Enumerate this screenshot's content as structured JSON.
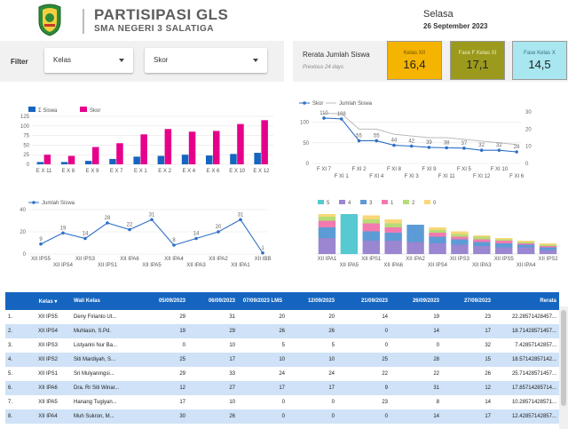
{
  "header": {
    "title": "PARTISIPASI GLS",
    "subtitle": "SMA NEGERI 3 SALATIGA",
    "day": "Selasa",
    "date": "26 September 2023",
    "logo_icon": "school-crest-icon"
  },
  "filter": {
    "label": "Filter",
    "dropdowns": [
      {
        "label": "Kelas"
      },
      {
        "label": "Skor"
      }
    ]
  },
  "kpi": {
    "title": "Rerata Jumlah Siswa",
    "subtitle": "Previous 24 days",
    "cards": [
      {
        "name": "Kelas XII",
        "value": "16,4",
        "color": "#f5b400"
      },
      {
        "name": "Fase F Kelas XI",
        "value": "17,1",
        "color": "#9c9a1c"
      },
      {
        "name": "Fase Kelas X",
        "value": "14,5",
        "color": "#a8e6f0"
      }
    ]
  },
  "chart_data": [
    {
      "type": "bar",
      "legend": [
        "Σ Siswa",
        "Skor"
      ],
      "colors": [
        "#1565c0",
        "#e6008a"
      ],
      "categories": [
        "E X 11",
        "E X 8",
        "E X 9",
        "E X 7",
        "E X 1",
        "E X 2",
        "E X 4",
        "E X 6",
        "E X 10",
        "E X 12"
      ],
      "series": [
        {
          "name": "Σ Siswa",
          "values": [
            6,
            6,
            9,
            14,
            20,
            22,
            25,
            23,
            27,
            30
          ]
        },
        {
          "name": "Skor",
          "values": [
            25,
            22,
            45,
            55,
            78,
            92,
            85,
            87,
            105,
            115
          ]
        }
      ],
      "y_ticks": [
        "0",
        "25",
        "50",
        "75",
        "100",
        "125"
      ],
      "ylim": [
        0,
        125
      ]
    },
    {
      "type": "line",
      "legend": [
        "Skor",
        "Jumlah Siswa"
      ],
      "colors": [
        "#2e6fc7",
        "#bbbbbb"
      ],
      "categories": [
        "F XI 7",
        "F XI 1",
        "F XI 2",
        "F XI 4",
        "F XI 8",
        "F XI 3",
        "F XI 9",
        "F XI 11",
        "F XI 5",
        "F XI 12",
        "F XI 10",
        "F XI 6"
      ],
      "series": [
        {
          "name": "Skor",
          "values": [
            110,
            108,
            55,
            55,
            44,
            42,
            39,
            38,
            37,
            32,
            32,
            28
          ]
        },
        {
          "name": "Jumlah Siswa",
          "values": [
            29,
            29,
            20,
            20,
            17,
            16,
            15,
            15,
            14,
            13,
            12,
            11
          ]
        }
      ],
      "data_labels": [
        "110",
        "108",
        "55",
        "55",
        "44",
        "42",
        "39",
        "38",
        "37",
        "32",
        "32",
        "28"
      ],
      "y_ticks_left": [
        "0",
        "50",
        "100"
      ],
      "y_ticks_right": [
        "0",
        "10",
        "20",
        "30"
      ]
    },
    {
      "type": "line",
      "legend": [
        "Jumlah Siswa"
      ],
      "colors": [
        "#2e6fc7"
      ],
      "categories": [
        "XII IPS5",
        "XII IPS4",
        "XII IPS3",
        "XII IPS1",
        "XII IPA6",
        "XII IPA5",
        "XII IPA4",
        "XII IPA3",
        "XII IPA2",
        "XII IPA1",
        "XII IBB"
      ],
      "series": [
        {
          "name": "Jumlah Siswa",
          "values": [
            9,
            19,
            14,
            28,
            22,
            31,
            8,
            14,
            20,
            31,
            1
          ]
        }
      ],
      "data_labels": [
        "9",
        "19",
        "14",
        "28",
        "22",
        "31",
        "8",
        "14",
        "20",
        "31",
        "1"
      ],
      "y_ticks": [
        "0",
        "20",
        "40"
      ]
    },
    {
      "type": "bar",
      "stacked": true,
      "legend": [
        "5",
        "4",
        "3",
        "1",
        "2",
        "0"
      ],
      "colors": [
        "#56c9d1",
        "#9a86d1",
        "#5c9bd6",
        "#f27ab0",
        "#b6dc76",
        "#f8d779"
      ],
      "categories": [
        "XII IPA1",
        "XII IPA5",
        "XII IPS1",
        "XII IPA6",
        "XII IPA2",
        "XII IPS4",
        "XII IPS3",
        "XII IPA3",
        "XII IPS5",
        "XII IPA4",
        "XII IPS2"
      ],
      "series": [
        {
          "name": "5",
          "values": [
            0,
            30,
            0,
            0,
            0,
            0,
            0,
            0,
            0,
            0,
            0
          ]
        },
        {
          "name": "4",
          "values": [
            12,
            0,
            10,
            10,
            9,
            8,
            7,
            6,
            5,
            5,
            3
          ]
        },
        {
          "name": "3",
          "values": [
            8,
            0,
            7,
            6,
            13,
            5,
            4,
            3,
            3,
            2,
            2
          ]
        },
        {
          "name": "1",
          "values": [
            5,
            0,
            6,
            4,
            0,
            3,
            2,
            2,
            2,
            1,
            1
          ]
        },
        {
          "name": "2",
          "values": [
            3,
            0,
            3,
            3,
            0,
            2,
            2,
            2,
            1,
            1,
            1
          ]
        },
        {
          "name": "0",
          "values": [
            2,
            0,
            3,
            3,
            0,
            2,
            2,
            1,
            1,
            1,
            1
          ]
        }
      ]
    }
  ],
  "table": {
    "columns": [
      "",
      "Kelas",
      "Wali Kelas",
      "05/09/2023",
      "06/09/2023",
      "07/09/2023 LMS",
      "12/09/2023",
      "21/09/2023",
      "26/09/2023",
      "27/09/2023",
      "Rerata"
    ],
    "rows": [
      [
        "1.",
        "XII IPS5",
        "Deny Firianto Ut...",
        "29",
        "31",
        "20",
        "20",
        "14",
        "19",
        "23",
        "22.28571428457..."
      ],
      [
        "2.",
        "XII IPS4",
        "Muhlasin, S.Pd.",
        "19",
        "29",
        "26",
        "26",
        "0",
        "14",
        "17",
        "18.71428571457..."
      ],
      [
        "3.",
        "XII IPS3",
        "Listyarini Nur Ba...",
        "0",
        "10",
        "5",
        "5",
        "0",
        "0",
        "32",
        "7.42857142857..."
      ],
      [
        "4.",
        "XII IPS2",
        "Siti Mardiyah, S...",
        "25",
        "17",
        "10",
        "10",
        "25",
        "28",
        "15",
        "18.57142857142..."
      ],
      [
        "5.",
        "XII IPS1",
        "Sri Mulyaningsi...",
        "29",
        "33",
        "24",
        "24",
        "22",
        "22",
        "26",
        "25.71428571457..."
      ],
      [
        "6.",
        "XII IPA6",
        "Dra. Rr Siti Winar...",
        "12",
        "27",
        "17",
        "17",
        "9",
        "31",
        "12",
        "17.85714285714..."
      ],
      [
        "7.",
        "XII IPA5",
        "Hanang Tugiyan...",
        "17",
        "10",
        "0",
        "0",
        "23",
        "8",
        "14",
        "10.28571428571..."
      ],
      [
        "8.",
        "XII IPA4",
        "Muh Sukron, M...",
        "30",
        "26",
        "0",
        "0",
        "0",
        "14",
        "17",
        "12.42857142857..."
      ]
    ]
  }
}
